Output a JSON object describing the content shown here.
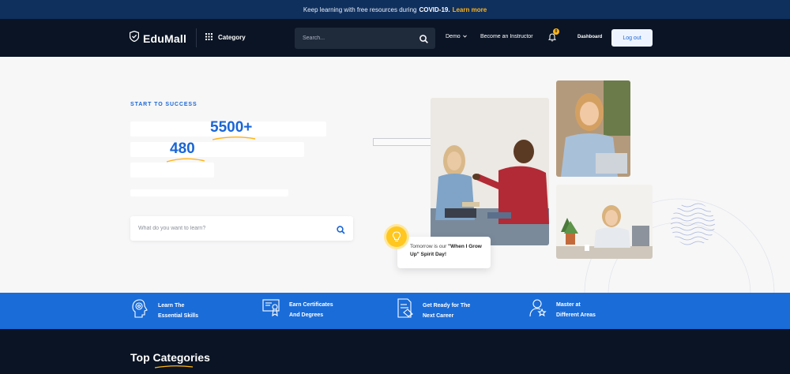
{
  "announcement": {
    "prefix": "Keep learning with free resources during",
    "highlight": "COVID-19.",
    "link": "Learn more"
  },
  "header": {
    "logo": "EduMall",
    "category": "Category",
    "search_placeholder": "Search...",
    "demo": "Demo",
    "instructor": "Become an Instructor",
    "notification_count": "0",
    "dashboard": "Dashboard",
    "logout": "Log out"
  },
  "hero": {
    "eyebrow": "START TO SUCCESS",
    "stat_courses": "5500+",
    "stat_institutions": "480",
    "search_placeholder": "What do you want to learn?",
    "bubble_prefix": "Tomorrow is our",
    "bubble_bold": "\"When I Grow Up\" Spirit Day!"
  },
  "features": [
    {
      "line1": "Learn The",
      "line2": "Essential Skills",
      "icon": "brain-icon"
    },
    {
      "line1": "Earn Certificates",
      "line2": "And Degrees",
      "icon": "certificate-icon"
    },
    {
      "line1": "Get Ready for The",
      "line2": "Next Career",
      "icon": "career-icon"
    },
    {
      "line1": "Master at",
      "line2": "Different Areas",
      "icon": "master-icon"
    }
  ],
  "section": {
    "title": "Top Categories"
  },
  "colors": {
    "navy": "#0a1424",
    "topbar": "#0f2f5d",
    "brand_blue": "#1a66d6",
    "accent_yellow": "#ffb414"
  }
}
